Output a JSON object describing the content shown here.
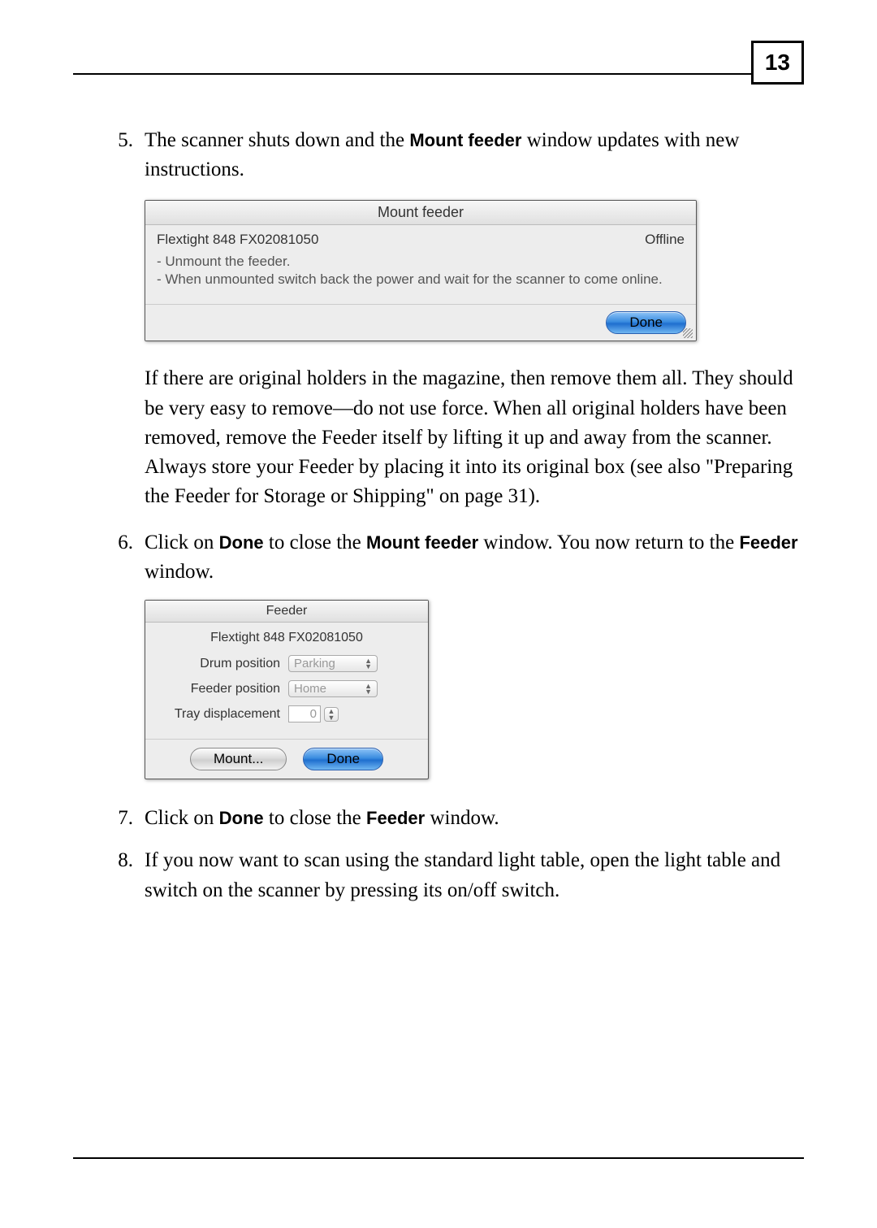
{
  "pageNumber": "13",
  "items": {
    "5": {
      "num": "5.",
      "textA": "The scanner shuts down and the ",
      "boldA": "Mount feeder",
      "textB": " window updates with new instructions.",
      "afterDialog": "If there are original holders in the magazine, then remove them all. They should be very easy to remove—do not use force. When all original holders have been removed, remove the Feeder itself by lifting it up and away from the scanner. Always store your Feeder by placing it into its original box (see also \"Preparing the Feeder for Storage or Shipping\" on page 31)."
    },
    "6": {
      "num": "6.",
      "textA": "Click on ",
      "boldA": "Done",
      "textB": " to close the ",
      "boldB": "Mount feeder",
      "textC": " window. You now return to the ",
      "boldC": "Feeder",
      "textD": " window."
    },
    "7": {
      "num": "7.",
      "textA": "Click on ",
      "boldA": "Done",
      "textB": " to close the ",
      "boldB": "Feeder",
      "textC": " window."
    },
    "8": {
      "num": "8.",
      "text": "If you now want to scan using the standard light table, open the light table and switch on the scanner by pressing its on/off switch."
    }
  },
  "dialog1": {
    "title": "Mount feeder",
    "device": "Flextight 848 FX02081050",
    "status": "Offline",
    "line1": "- Unmount the feeder.",
    "line2": "- When unmounted switch back the power and wait for the scanner to come online.",
    "done": "Done"
  },
  "dialog2": {
    "title": "Feeder",
    "device": "Flextight 848 FX02081050",
    "drumLabel": "Drum position",
    "drumValue": "Parking",
    "feederLabel": "Feeder position",
    "feederValue": "Home",
    "trayLabel": "Tray displacement",
    "trayValue": "0",
    "mount": "Mount...",
    "done": "Done"
  }
}
